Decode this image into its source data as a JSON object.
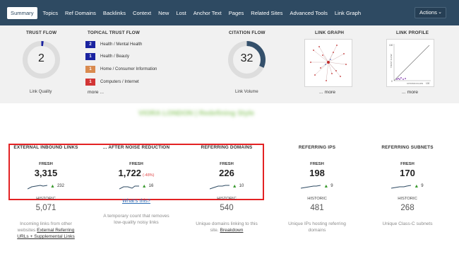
{
  "nav": {
    "tabs": [
      "Summary",
      "Topics",
      "Ref Domains",
      "Backlinks",
      "Context",
      "New",
      "Lost",
      "Anchor Text",
      "Pages",
      "Related Sites",
      "Advanced Tools",
      "Link Graph"
    ],
    "actions_label": "Actions"
  },
  "trust_flow": {
    "title": "TRUST FLOW",
    "value": "2",
    "caption": "Link Quality",
    "fraction": 0.02
  },
  "topical_trust_flow": {
    "title": "TOPICAL TRUST FLOW",
    "items": [
      {
        "score": "2",
        "label": "Health / Mental Health",
        "color": "#1a23a0"
      },
      {
        "score": "1",
        "label": "Health / Beauty",
        "color": "#1a23a0"
      },
      {
        "score": "1",
        "label": "Home / Consumer Information",
        "color": "#d98a4f"
      },
      {
        "score": "1",
        "label": "Computers / Internet",
        "color": "#d23535"
      }
    ],
    "more": "more ..."
  },
  "citation_flow": {
    "title": "CITATION FLOW",
    "value": "32",
    "caption": "Link Volume",
    "fraction": 0.32
  },
  "link_graph": {
    "title": "LINK GRAPH",
    "more": "... more"
  },
  "link_profile": {
    "title": "LINK PROFILE",
    "more": "... more",
    "x_label": "CITATION FLOW",
    "y_label": "TRUST FLOW",
    "tick_y_top": "100",
    "tick_y_bottom": "0",
    "tick_x_right": "100"
  },
  "site_title": "VIORA LONDON | Redefining Style",
  "stats": [
    {
      "title": "EXTERNAL INBOUND LINKS",
      "fresh_label": "FRESH",
      "fresh_value": "3,315",
      "delta": "",
      "trend_value": "232",
      "history_label": "HISTORIC",
      "history_value": "5,071",
      "desc": "Incoming links from other websites",
      "desc_link": "External Referring URLs + Supplemental Links"
    },
    {
      "title": "... AFTER NOISE REDUCTION",
      "fresh_label": "FRESH",
      "fresh_value": "1,722",
      "delta": "(-48%)",
      "trend_value": "16",
      "whats_this": "What's this?",
      "desc": "A temporary count that removes low-quality noisy links",
      "desc_link": ""
    },
    {
      "title": "REFERRING DOMAINS",
      "fresh_label": "FRESH",
      "fresh_value": "226",
      "delta": "",
      "trend_value": "10",
      "history_label": "HISTORIC",
      "history_value": "540",
      "desc": "Unique domains linking to this site.",
      "desc_link": "Breakdown"
    },
    {
      "title": "REFERRING IPS",
      "fresh_label": "FRESH",
      "fresh_value": "198",
      "delta": "",
      "trend_value": "9",
      "history_label": "HISTORIC",
      "history_value": "481",
      "desc": "Unique IPs hosting referring domains",
      "desc_link": ""
    },
    {
      "title": "REFERRING SUBNETS",
      "fresh_label": "FRESH",
      "fresh_value": "170",
      "delta": "",
      "trend_value": "9",
      "history_label": "HISTORIC",
      "history_value": "268",
      "desc": "Unique Class-C subnets",
      "desc_link": ""
    }
  ],
  "colors": {
    "nav_bg": "#2e4a62",
    "donut_track": "#dddddd",
    "donut_fill": "#34506b",
    "trend_up": "#3a9a2e",
    "delta_red": "#e04848",
    "highlight": "#e32224"
  }
}
